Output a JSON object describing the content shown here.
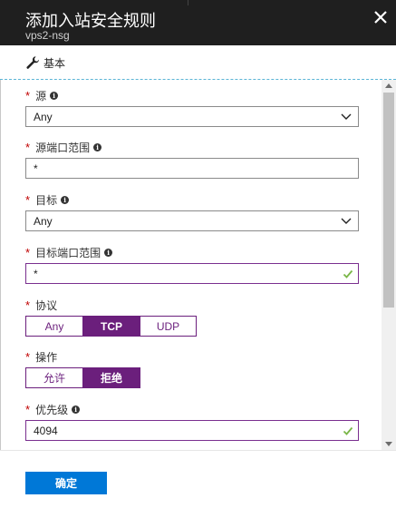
{
  "header": {
    "title": "添加入站安全规则",
    "subtitle": "vps2-nsg"
  },
  "tabs": [
    {
      "label": "基本",
      "icon": "wrench-icon"
    }
  ],
  "fields": {
    "source": {
      "label": "源",
      "required": true,
      "value": "Any"
    },
    "source_port": {
      "label": "源端口范围",
      "required": true,
      "value": "*"
    },
    "destination": {
      "label": "目标",
      "required": true,
      "value": "Any"
    },
    "destination_port": {
      "label": "目标端口范围",
      "required": true,
      "value": "*"
    },
    "protocol": {
      "label": "协议",
      "required": true,
      "options": [
        "Any",
        "TCP",
        "UDP"
      ],
      "selected": "TCP"
    },
    "action": {
      "label": "操作",
      "required": true,
      "options": [
        "允许",
        "拒绝"
      ],
      "selected": "拒绝"
    },
    "priority": {
      "label": "优先级",
      "required": true,
      "value": "4094"
    }
  },
  "required_marker": "*",
  "info_glyph": "i",
  "footer": {
    "ok_label": "确定"
  },
  "colors": {
    "header_bg": "#1f1f1f",
    "accent_purple": "#6b1f7c",
    "primary_button": "#0078d7",
    "valid_check": "#7ab648",
    "required_star": "#c00000"
  }
}
